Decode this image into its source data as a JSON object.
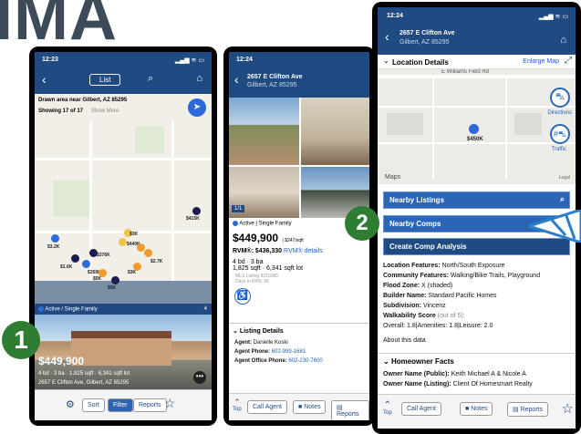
{
  "banner": "IMA",
  "phone1": {
    "status_time": "12:23",
    "list_label": "List",
    "drawn_area": "Drawn area near Gilbert, AZ 85295",
    "showing": "Showing 17 of 17",
    "show_more": "Show More",
    "map_prices": [
      "$415K",
      "$3.2K",
      "$3K",
      "$440K",
      "$376K",
      "$2.0K",
      "$1.6K",
      "$350K",
      "$3.2K",
      "$2.7K",
      "$3K",
      "$3K",
      "$3K",
      "$5K",
      "$5K",
      "$35K",
      "New",
      "New",
      "New"
    ],
    "status_label": "Active / Single Family",
    "photo_count": "4",
    "listing_price": "$449,900",
    "listing_specs": "4 bd · 3 ba · 1,825 sqft · 6,341 sqft lot",
    "listing_address": "2657 E Clifton Ave, Gilbert, AZ 85295",
    "sort_label": "Sort",
    "filter_label": "Filter",
    "reports_label": "Reports",
    "step": "1"
  },
  "phone2": {
    "status_time": "12:24",
    "address_line1": "2657 E Clifton Ave",
    "address_line2": "Gilbert, AZ 85295",
    "photo_index": "1/1",
    "status_label": "Active | Single Family",
    "price": "$449,900",
    "price_per_sqft": "| $247/sqft",
    "rvm": "RVM®: $436,330",
    "rvm_details": "RVM® details",
    "beds_baths": "4 bd · 3 ba",
    "sqft": "1,825 sqft · 6,341 sqft lot",
    "mls": "· MLS Listing 6210385",
    "days": "· Days in RPR: 66",
    "listing_details_header": "Listing Details",
    "agent_label": "Agent:",
    "agent_name": "Danielle Koski",
    "agent_phone_label": "Agent Phone:",
    "agent_phone": "602-999-1681",
    "office_phone_label": "Agent Office Phone:",
    "office_phone": "602-230-7600",
    "call_agent": "Call Agent",
    "notes": "Notes",
    "reports": "Reports",
    "top": "Top"
  },
  "phone3": {
    "status_time": "12:24",
    "address_line1": "2657 E Clifton Ave",
    "address_line2": "Gilbert, AZ 85295",
    "location_header": "Location Details",
    "enlarge_map": "Enlarge Map",
    "street_label": "E Williams Field Rd",
    "pin_price": "$450K",
    "directions": "Directions",
    "traffic": "Traffic",
    "maps_label": "Maps",
    "legal": "Legal",
    "nearby_listings": "Nearby Listings",
    "nearby_comps": "Nearby Comps",
    "create_comp": "Create Comp Analysis",
    "loc_features_label": "Location Features:",
    "loc_features": "North/South Exposure",
    "community_label": "Community Features:",
    "community": "Walking/Bike Trails, Playground",
    "flood_label": "Flood Zone:",
    "flood": "X (shaded)",
    "builder_label": "Builder Name:",
    "builder": "Standard Pacific Homes",
    "subdivision_label": "Subdivision:",
    "subdivision": "Vincenz",
    "walk_label": "Walkability Score",
    "walk_out_of": "(out of 5):",
    "walk_values": "Overall: 1.8|Amenities: 1.8|Leisure: 2.0",
    "about": "About this data",
    "homeowner_header": "Homeowner Facts",
    "owner_public_label": "Owner Name (Public):",
    "owner_public": "Keith Michael A & Nicole A",
    "owner_listing_label": "Owner Name (Listing):",
    "owner_listing": "Client Of Homesmart Realty",
    "call_agent": "Call Agent",
    "notes": "Notes",
    "reports": "Reports",
    "top": "Top",
    "step": "2"
  }
}
